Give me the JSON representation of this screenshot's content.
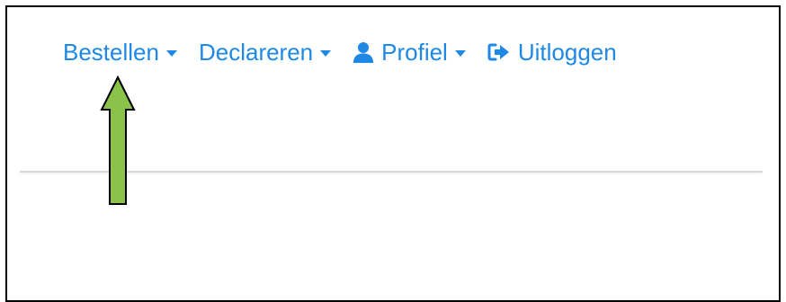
{
  "nav": {
    "items": [
      {
        "label": "Bestellen",
        "icon": "caret-down-icon",
        "dropdown": true
      },
      {
        "label": "Declareren",
        "icon": "caret-down-icon",
        "dropdown": true
      },
      {
        "label": "Profiel",
        "icon": "user-icon",
        "dropdown": true
      },
      {
        "label": "Uitloggen",
        "icon": "sign-out-icon",
        "dropdown": false
      }
    ]
  },
  "colors": {
    "link": "#1e88e5",
    "arrow_fill": "#8bc34a",
    "arrow_stroke": "#000000",
    "divider": "#d9d9d9"
  },
  "annotation": {
    "icon": "up-arrow-pointer-icon",
    "target": "Bestellen"
  }
}
